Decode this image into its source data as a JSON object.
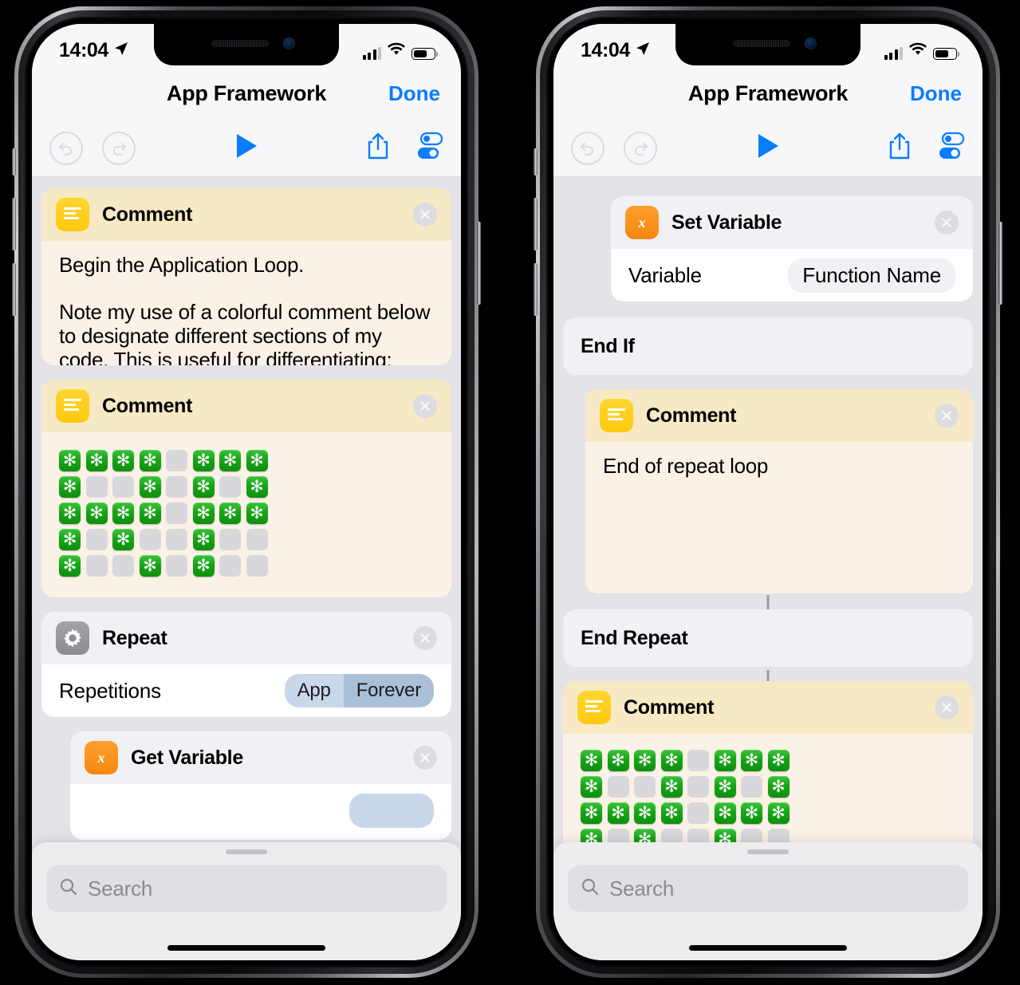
{
  "app": {
    "title": "App Framework",
    "done_label": "Done"
  },
  "status_bar": {
    "time": "14:04",
    "location_icon": "location-arrow-icon",
    "signal_icon": "cellular-signal-icon",
    "wifi_icon": "wifi-icon",
    "battery_icon": "battery-icon"
  },
  "toolbar": {
    "undo_icon": "undo-icon",
    "redo_icon": "redo-icon",
    "play_icon": "play-icon",
    "share_icon": "share-icon",
    "settings_icon": "toggles-settings-icon"
  },
  "search": {
    "placeholder": "Search",
    "icon": "search-icon"
  },
  "left_phone": {
    "actions": [
      {
        "type": "comment",
        "icon": "comment-lines-icon",
        "title": "Comment",
        "remove_icon": "close-circle-icon",
        "text": "Begin the Application Loop.\n\nNote my use of a colorful comment below to designate different sections of my code. This is useful for differentiating: Repeat Loops, Classes, Functions"
      },
      {
        "type": "comment-grid",
        "icon": "comment-lines-icon",
        "title": "Comment",
        "remove_icon": "close-circle-icon"
      },
      {
        "type": "repeat",
        "icon": "gear-icon",
        "title": "Repeat",
        "remove_icon": "close-circle-icon",
        "row_label": "Repetitions",
        "segment": [
          "App",
          "Forever"
        ]
      },
      {
        "type": "variable",
        "icon": "variable-x-icon",
        "title": "Get Variable",
        "remove_icon": "close-circle-icon"
      }
    ]
  },
  "right_phone": {
    "actions": [
      {
        "type": "variable",
        "icon": "variable-x-icon",
        "title": "Set Variable",
        "remove_icon": "close-circle-icon",
        "row_label": "Variable",
        "row_value": "Function Name"
      },
      {
        "type": "plain",
        "title": "End If"
      },
      {
        "type": "comment",
        "icon": "comment-lines-icon",
        "title": "Comment",
        "remove_icon": "close-circle-icon",
        "text": "End of repeat loop"
      },
      {
        "type": "plain",
        "title": "End Repeat"
      },
      {
        "type": "comment-grid",
        "icon": "comment-lines-icon",
        "title": "Comment",
        "remove_icon": "close-circle-icon"
      }
    ]
  },
  "asterisk_grid": {
    "columns": 8,
    "rows": 5,
    "glyph": "✻",
    "on_color": "#16a516",
    "off_color": "#d8d8dc",
    "pattern": [
      [
        1,
        1,
        1,
        1,
        0,
        1,
        1,
        1
      ],
      [
        1,
        0,
        0,
        1,
        0,
        1,
        0,
        1
      ],
      [
        1,
        1,
        1,
        1,
        0,
        1,
        1,
        1
      ],
      [
        1,
        0,
        1,
        0,
        0,
        1,
        0,
        0
      ],
      [
        1,
        0,
        0,
        1,
        0,
        1,
        0,
        0
      ]
    ]
  },
  "colors": {
    "accent": "#0a7cff",
    "canvas_bg": "#e3e3e8",
    "comment_header": "#f7e9c4",
    "comment_body": "#faf2e6",
    "card_bg": "#f1f1f5"
  }
}
